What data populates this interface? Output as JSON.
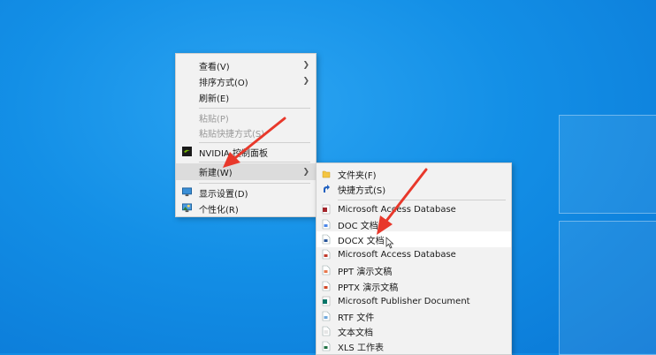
{
  "context_menu": {
    "items": [
      {
        "label": "查看(V)",
        "has_submenu": true
      },
      {
        "label": "排序方式(O)",
        "has_submenu": true
      },
      {
        "label": "刷新(E)"
      },
      {
        "label": "粘贴(P)",
        "disabled": true
      },
      {
        "label": "粘贴快捷方式(S)",
        "disabled": true
      },
      {
        "label": "NVIDIA 控制面板",
        "icon": "nvidia-icon"
      },
      {
        "label": "新建(W)",
        "has_submenu": true,
        "highlighted": true
      },
      {
        "label": "显示设置(D)",
        "icon": "display-settings-icon"
      },
      {
        "label": "个性化(R)",
        "icon": "personalize-icon"
      }
    ]
  },
  "new_submenu": {
    "items": [
      {
        "label": "文件夹(F)",
        "icon": "folder-icon"
      },
      {
        "label": "快捷方式(S)",
        "icon": "shortcut-icon"
      },
      {
        "label": "Microsoft Access Database",
        "icon": "access-icon"
      },
      {
        "label": "DOC 文档",
        "icon": "doc-icon"
      },
      {
        "label": "DOCX 文档",
        "icon": "docx-icon",
        "highlighted": true
      },
      {
        "label": "Microsoft Access Database",
        "icon": "access-icon"
      },
      {
        "label": "PPT 演示文稿",
        "icon": "ppt-icon"
      },
      {
        "label": "PPTX 演示文稿",
        "icon": "pptx-icon"
      },
      {
        "label": "Microsoft Publisher Document",
        "icon": "publisher-icon"
      },
      {
        "label": "RTF 文件",
        "icon": "rtf-icon"
      },
      {
        "label": "文本文档",
        "icon": "text-doc-icon"
      },
      {
        "label": "XLS 工作表",
        "icon": "xls-icon"
      }
    ]
  },
  "colors": {
    "accent_red": "#e8382b",
    "menu_bg": "#f2f2f2"
  }
}
